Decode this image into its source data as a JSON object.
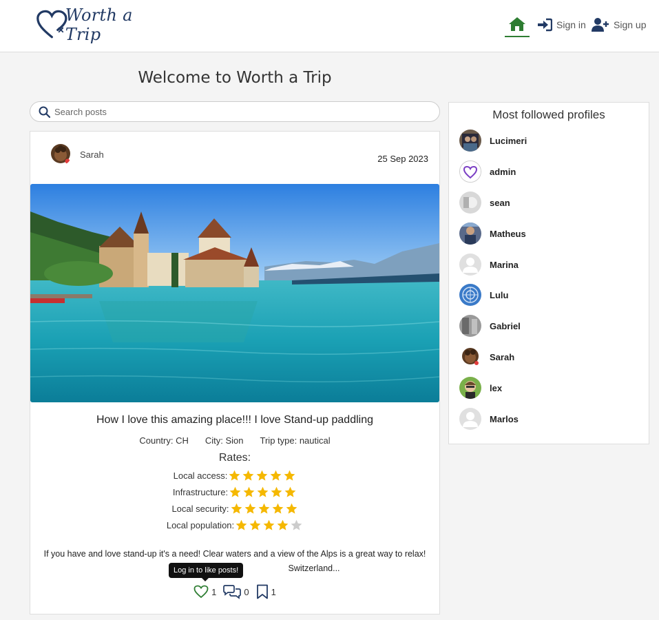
{
  "nav": {
    "brand": "Worth a Trip",
    "home_icon": "home-icon",
    "signin_label": "Sign in",
    "signup_label": "Sign up",
    "accent": "#2e7d32",
    "brand_color": "#223a64"
  },
  "page_title": "Welcome to Worth a Trip",
  "search": {
    "placeholder": "Search posts",
    "value": ""
  },
  "post": {
    "author": "Sarah",
    "date": "25 Sep 2023",
    "image_alt": "lakeside castle with mountains",
    "title": "How I love this amazing place!!! I love Stand-up paddling",
    "country": "Country: CH",
    "city": "City: Sion",
    "trip_type": "Trip type: nautical",
    "rates_heading": "Rates:",
    "rates": [
      {
        "label": "Local access:",
        "stars": 5
      },
      {
        "label": "Infrastructure:",
        "stars": 5
      },
      {
        "label": "Local security:",
        "stars": 5
      },
      {
        "label": "Local population:",
        "stars": 4
      }
    ],
    "description_line1": "If you have and love stand-up it's a need! Clear waters and a view of the Alps is a great way to relax!",
    "description_line2": "Switzerland...",
    "tooltip": "Log in to like posts!",
    "likes": "1",
    "comments": "0",
    "bookmarks": "1",
    "star_color": "#f5b800",
    "star_empty_color": "#cccccc"
  },
  "sidebar": {
    "title": "Most followed profiles",
    "profiles": [
      {
        "name": "Lucimeri"
      },
      {
        "name": "admin"
      },
      {
        "name": "sean"
      },
      {
        "name": "Matheus"
      },
      {
        "name": "Marina"
      },
      {
        "name": "Lulu"
      },
      {
        "name": "Gabriel"
      },
      {
        "name": "Sarah"
      },
      {
        "name": "lex"
      },
      {
        "name": "Marlos"
      }
    ]
  }
}
